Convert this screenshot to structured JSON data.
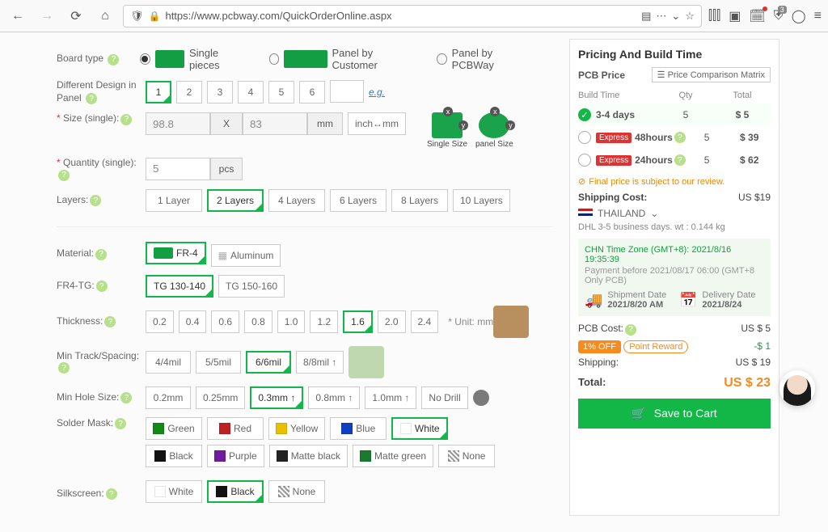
{
  "browser": {
    "url": "https://www.pcbway.com/QuickOrderOnline.aspx",
    "badge": "3"
  },
  "board_type": {
    "label": "Board type",
    "options": [
      "Single pieces",
      "Panel by Customer",
      "Panel by PCBWay"
    ],
    "selected": 0
  },
  "diff_design": {
    "label": "Different Design in Panel",
    "nums": [
      "1",
      "2",
      "3",
      "4",
      "5",
      "6"
    ],
    "eg": "e.g."
  },
  "size": {
    "label": "Size (single):",
    "w": "98.8",
    "h": "83",
    "x": "X",
    "unit": "mm",
    "toggle": "inch↔mm"
  },
  "size_diag": {
    "single": "Single Size",
    "panel": "panel Size"
  },
  "qty": {
    "label": "Quantity (single):",
    "val": "5",
    "unit": "pcs"
  },
  "layers": {
    "label": "Layers:",
    "options": [
      "1 Layer",
      "2 Layers",
      "4 Layers",
      "6 Layers",
      "8 Layers",
      "10 Layers"
    ],
    "selected": 1
  },
  "material": {
    "label": "Material:",
    "options": [
      "FR-4",
      "Aluminum"
    ],
    "selected": 0
  },
  "fr4tg": {
    "label": "FR4-TG:",
    "options": [
      "TG 130-140",
      "TG 150-160"
    ],
    "selected": 0
  },
  "thickness": {
    "label": "Thickness:",
    "options": [
      "0.2",
      "0.4",
      "0.6",
      "0.8",
      "1.0",
      "1.2",
      "1.6",
      "2.0",
      "2.4"
    ],
    "selected": 6,
    "unit": "* Unit: mm"
  },
  "track": {
    "label": "Min Track/Spacing:",
    "options": [
      "4/4mil",
      "5/5mil",
      "6/6mil",
      "8/8mil ↑"
    ],
    "selected": 2
  },
  "hole": {
    "label": "Min Hole Size:",
    "options": [
      "0.2mm",
      "0.25mm",
      "0.3mm ↑",
      "0.8mm ↑",
      "1.0mm ↑",
      "No Drill"
    ],
    "selected": 2
  },
  "solder": {
    "label": "Solder Mask:",
    "options": [
      {
        "name": "Green",
        "c": "#138a17"
      },
      {
        "name": "Red",
        "c": "#c02020"
      },
      {
        "name": "Yellow",
        "c": "#e8c000"
      },
      {
        "name": "Blue",
        "c": "#1040c0"
      },
      {
        "name": "White",
        "c": "#ffffff"
      },
      {
        "name": "Black",
        "c": "#111"
      },
      {
        "name": "Purple",
        "c": "#701aa0"
      },
      {
        "name": "Matte black",
        "c": "#222"
      },
      {
        "name": "Matte green",
        "c": "#1a7a30"
      },
      {
        "name": "None",
        "c": "repeating-linear-gradient(45deg,#999,#999 2px,#fff 2px,#fff 4px)"
      }
    ],
    "selected": 4
  },
  "silk": {
    "label": "Silkscreen:",
    "options": [
      {
        "name": "White",
        "c": "#ffffff"
      },
      {
        "name": "Black",
        "c": "#111"
      },
      {
        "name": "None",
        "c": "repeating-linear-gradient(45deg,#999,#999 2px,#fff 2px,#fff 4px)"
      }
    ],
    "selected": 1
  },
  "pricing": {
    "title": "Pricing And Build Time",
    "pcb_price": "PCB Price",
    "compare": "Price Comparison Matrix",
    "headers": [
      "Build Time",
      "Qty",
      "Total"
    ],
    "rows": [
      {
        "express": false,
        "time": "3-4 days",
        "qty": "5",
        "total": "$ 5",
        "on": true
      },
      {
        "express": true,
        "time": "48hours",
        "qty": "5",
        "total": "$ 39",
        "on": false
      },
      {
        "express": true,
        "time": "24hours",
        "qty": "5",
        "total": "$ 62",
        "on": false
      }
    ],
    "express_label": "Express",
    "review": "Final price is subject to our review.",
    "shipping_cost": "Shipping Cost:",
    "shipping_val": "US $19",
    "country": "THAILAND",
    "dhl": "DHL   3-5 business days.    wt : 0.144 kg",
    "tz": "CHN Time Zone (GMT+8): 2021/8/16 19:35:39",
    "payment": "Payment before 2021/08/17 06:00 (GMT+8 Only PCB)",
    "ship_date_lbl": "Shipment Date",
    "ship_date": "2021/8/20 AM",
    "deliv_date_lbl": "Delivery Date",
    "deliv_date": "2021/8/24",
    "pcb_cost_lbl": "PCB Cost:",
    "pcb_cost": "US $ 5",
    "off": "1% OFF",
    "reward": "Point Reward",
    "discount": "-$ 1",
    "shipping_lbl": "Shipping:",
    "shipping": "US $ 19",
    "total_lbl": "Total:",
    "total": "US $ 23",
    "save": "Save to Cart"
  }
}
